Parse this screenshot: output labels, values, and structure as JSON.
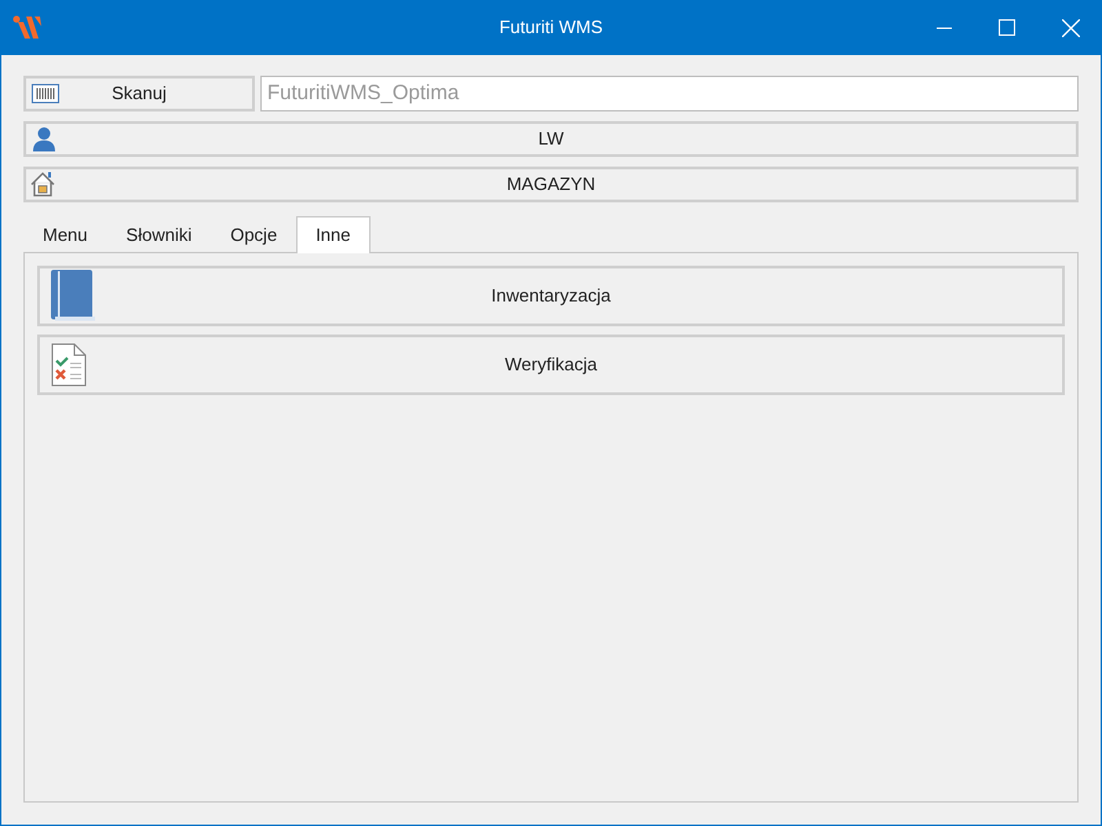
{
  "window": {
    "title": "Futuriti WMS"
  },
  "scan_button": {
    "label": "Skanuj"
  },
  "scan_field": {
    "placeholder": "FuturitiWMS_Optima"
  },
  "user_button": {
    "label": "LW"
  },
  "warehouse_button": {
    "label": "MAGAZYN"
  },
  "tabs": [
    {
      "label": "Menu",
      "selected": false
    },
    {
      "label": "Słowniki",
      "selected": false
    },
    {
      "label": "Opcje",
      "selected": false
    },
    {
      "label": "Inne",
      "selected": true
    }
  ],
  "actions": [
    {
      "label": "Inwentaryzacja",
      "kind": "book"
    },
    {
      "label": "Weryfikacja",
      "kind": "checklist"
    }
  ]
}
